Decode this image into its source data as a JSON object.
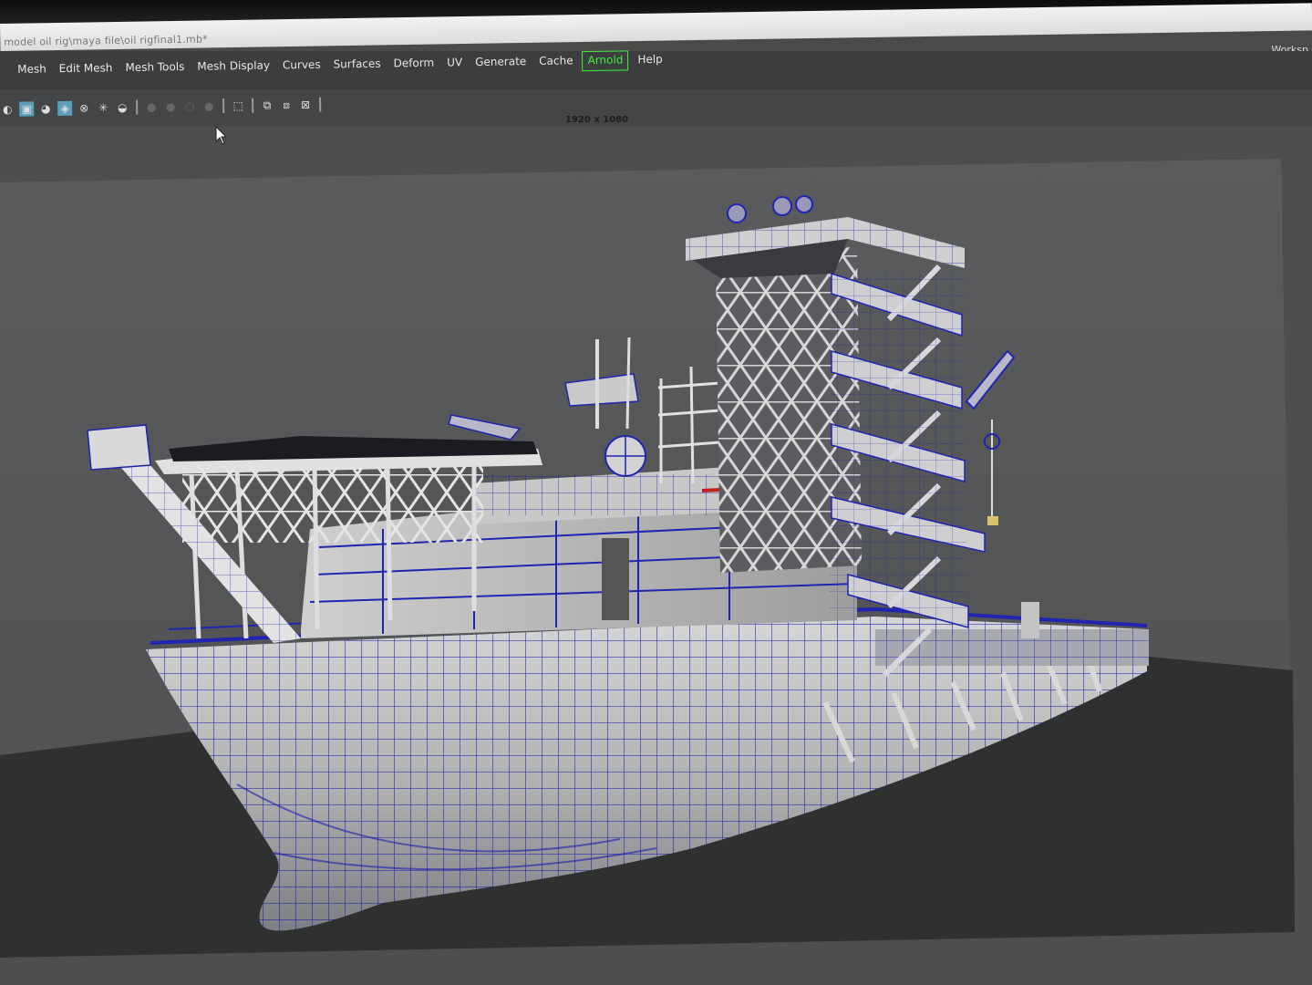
{
  "window": {
    "title": "model oil rig\\maya file\\oil rigfinal1.mb*",
    "workspace_label": "Worksp"
  },
  "menu": {
    "items": [
      {
        "label": "Mesh"
      },
      {
        "label": "Edit Mesh"
      },
      {
        "label": "Mesh Tools"
      },
      {
        "label": "Mesh Display"
      },
      {
        "label": "Curves"
      },
      {
        "label": "Surfaces"
      },
      {
        "label": "Deform"
      },
      {
        "label": "UV"
      },
      {
        "label": "Generate"
      },
      {
        "label": "Cache"
      },
      {
        "label": "Arnold"
      },
      {
        "label": "Help"
      }
    ]
  },
  "toolbar": {
    "icons": [
      "shading-mode-icon",
      "textured-icon",
      "lighting-icon",
      "active-select-icon",
      "wireframe-shaded-icon",
      "light-icon",
      "shadow-icon",
      "ssao-icon",
      "motion-blur-icon",
      "antialias-icon",
      "dof-icon",
      "isolate-select-icon",
      "xray-icon",
      "xray-joints-icon",
      "grid-icon"
    ]
  },
  "viewport": {
    "resolution_label": "1920 x 1080",
    "model_name": "oil rig ship",
    "background_color": "#55565a",
    "ground_color": "#2d302f",
    "wireframe_color": "#1a1eaa",
    "mesh_color": "#c9c9c9"
  },
  "colors": {
    "menubar": "#3c3d3f",
    "arnold_accent": "#3cf03c",
    "active_tool": "#5b9fb8"
  }
}
